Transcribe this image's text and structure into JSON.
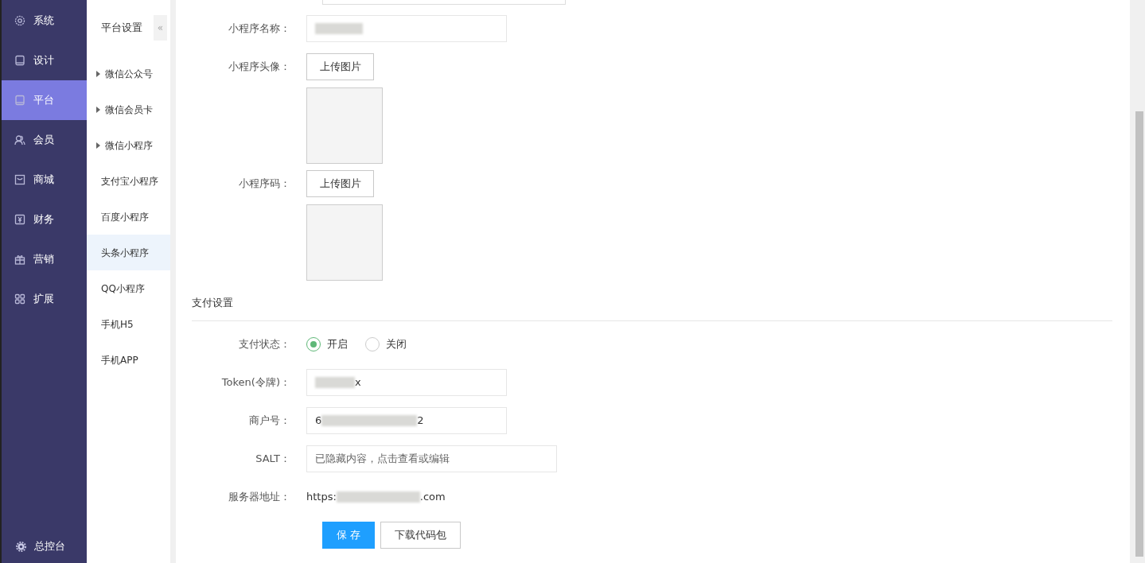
{
  "main_menu": [
    {
      "label": "系统",
      "selected": false
    },
    {
      "label": "设计",
      "selected": false
    },
    {
      "label": "平台",
      "selected": true
    },
    {
      "label": "会员",
      "selected": false
    },
    {
      "label": "商城",
      "selected": false
    },
    {
      "label": "财务",
      "selected": false
    },
    {
      "label": "营销",
      "selected": false
    },
    {
      "label": "扩展",
      "selected": false
    }
  ],
  "console_link": {
    "label": "总控台"
  },
  "sub_menu": {
    "title": "平台设置",
    "collapse": "«",
    "items": [
      {
        "label": "微信公众号",
        "expandable": true,
        "selected": false
      },
      {
        "label": "微信会员卡",
        "expandable": true,
        "selected": false
      },
      {
        "label": "微信小程序",
        "expandable": true,
        "selected": false
      },
      {
        "label": "支付宝小程序",
        "expandable": false,
        "selected": false
      },
      {
        "label": "百度小程序",
        "expandable": false,
        "selected": false
      },
      {
        "label": "头条小程序",
        "expandable": false,
        "selected": true
      },
      {
        "label": "QQ小程序",
        "expandable": false,
        "selected": false
      },
      {
        "label": "手机H5",
        "expandable": false,
        "selected": false
      },
      {
        "label": "手机APP",
        "expandable": false,
        "selected": false
      }
    ]
  },
  "form_rows": [
    {
      "kind": "cutoff"
    },
    {
      "kind": "input",
      "label": "小程序名称：",
      "redacted": true
    },
    {
      "kind": "upload",
      "label": "小程序头像：",
      "button": "上传图片"
    },
    {
      "kind": "upload",
      "label": "小程序码：",
      "button": "上传图片"
    },
    {
      "kind": "section",
      "title": "支付设置"
    },
    {
      "kind": "radio",
      "label": "支付状态：",
      "options": [
        {
          "label": "开启",
          "selected": true
        },
        {
          "label": "关闭",
          "selected": false
        }
      ]
    },
    {
      "kind": "input",
      "label": "Token(令牌)：",
      "redacted": true,
      "value_end": "x"
    },
    {
      "kind": "input",
      "label": "商户号：",
      "redacted": true,
      "value_start": "6",
      "value_end": "2"
    },
    {
      "kind": "input",
      "label": "SALT：",
      "wide": true,
      "placeholder": "已隐藏内容，点击查看或编辑"
    },
    {
      "kind": "text",
      "label": "服务器地址：",
      "redacted": true,
      "value_start": "https:",
      "value_end": ".com"
    },
    {
      "kind": "buttons",
      "buttons": [
        {
          "label": "保 存",
          "primary": true
        },
        {
          "label": "下载代码包",
          "primary": false
        }
      ]
    }
  ]
}
